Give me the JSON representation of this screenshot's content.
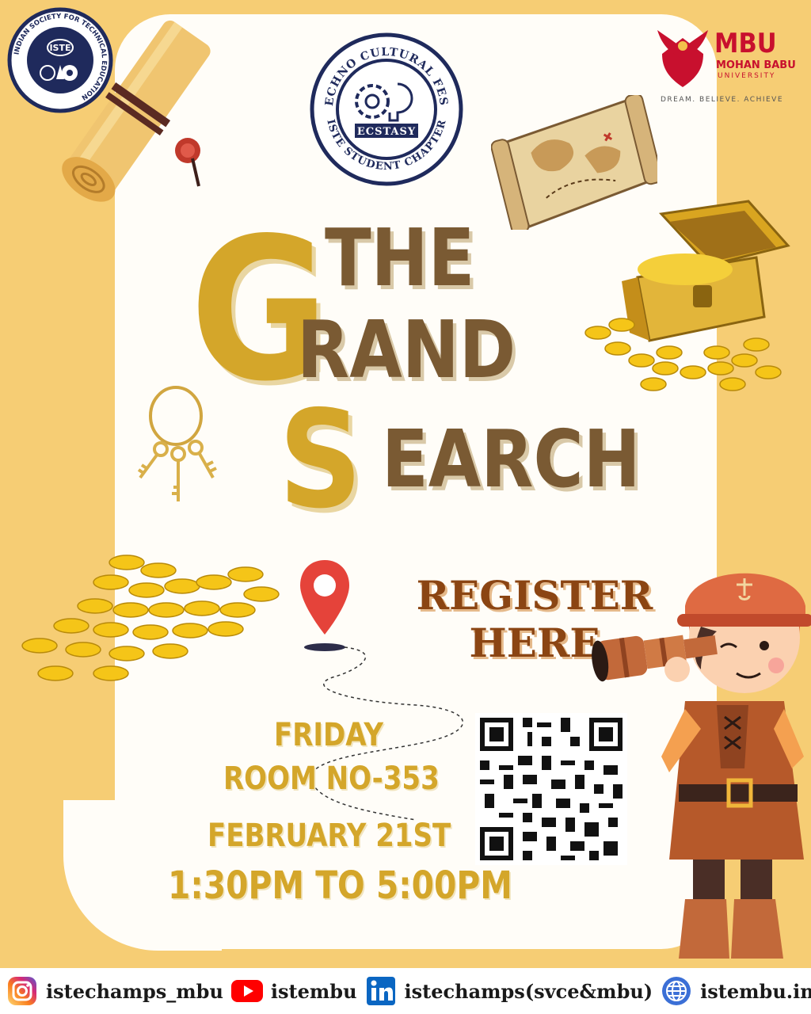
{
  "logos": {
    "iste": {
      "center_text": "ISTE",
      "ring_text": "INDIAN SOCIETY FOR TECHNICAL EDUCATION"
    },
    "ecstasy": {
      "top_text": "TECHNO CULTURAL FEST",
      "name": "ECSTASY",
      "bottom_text": "ISTE STUDENT CHAPTER"
    },
    "mbu": {
      "abbr": "MBU",
      "line1": "MOHAN BABU",
      "line2": "UNIVERSITY",
      "tagline": "DREAM. BELIEVE. ACHIEVE"
    }
  },
  "headline": {
    "the": "THE",
    "g": "G",
    "rand": "RAND",
    "s": "S",
    "earch": "EARCH"
  },
  "register": {
    "line1": "REGISTER",
    "line2": "HERE"
  },
  "event": {
    "day": "FRIDAY",
    "room": "ROOM NO-353",
    "date": "FEBRUARY 21ST",
    "time": "1:30PM TO 5:00PM"
  },
  "socials": [
    {
      "icon": "instagram-icon",
      "label": "istechamps_mbu"
    },
    {
      "icon": "youtube-icon",
      "label": "istembu"
    },
    {
      "icon": "linkedin-icon",
      "label": "istechamps(svce&mbu)"
    },
    {
      "icon": "globe-icon",
      "label": "istembu.in"
    }
  ],
  "colors": {
    "background": "#f6cd74",
    "gold": "#d4a62a",
    "brown": "#7a5a33",
    "register": "#8b4513",
    "navy": "#1f2a5c",
    "mbu_red": "#c8102e"
  }
}
